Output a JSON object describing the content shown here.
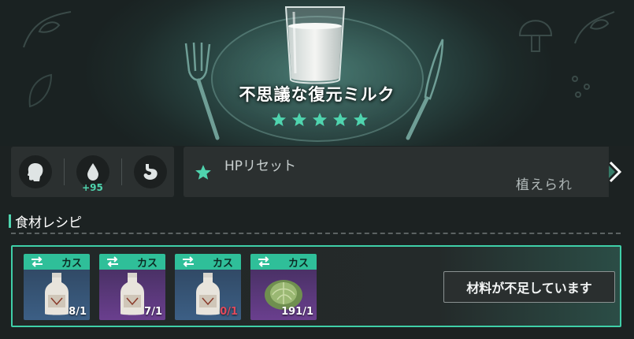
{
  "item": {
    "name": "不思議な復元ミルク",
    "stars": 5,
    "image": "milk-glass-icon"
  },
  "stats": [
    {
      "icon": "head-icon",
      "value": ""
    },
    {
      "icon": "water-drop-icon",
      "value": "+95"
    },
    {
      "icon": "stomach-icon",
      "value": ""
    }
  ],
  "effect": {
    "name": "HPリセット",
    "subtext": "植えられ",
    "icon": "star-icon"
  },
  "recipe": {
    "title": "食材レシピ",
    "ingredients": [
      {
        "tag": "カス",
        "icon": "milk-bottle-icon",
        "count": "8/1",
        "rarity": "blue",
        "insufficient": false
      },
      {
        "tag": "カス",
        "icon": "milk-bottle-icon",
        "count": "7/1",
        "rarity": "purple",
        "insufficient": false
      },
      {
        "tag": "カス",
        "icon": "milk-bottle-icon",
        "count": "0/1",
        "rarity": "blue",
        "insufficient": true
      },
      {
        "tag": "カス",
        "icon": "cabbage-icon",
        "count": "191/1",
        "rarity": "purple",
        "insufficient": false
      }
    ],
    "status_button": "材料が不足しています"
  },
  "colors": {
    "accent": "#4fd4ae",
    "tag": "#2fbf99",
    "shortage": "#e04a5c"
  }
}
